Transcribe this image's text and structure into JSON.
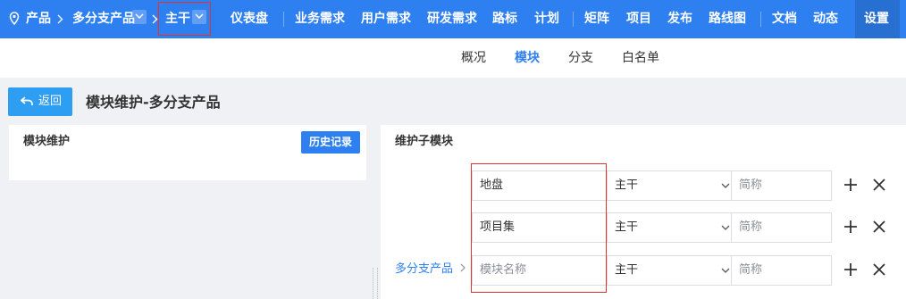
{
  "nav": {
    "breadcrumb": {
      "product": "产品",
      "product_name": "多分支产品",
      "branch": "主干"
    },
    "menu": [
      "仪表盘",
      "业务需求",
      "用户需求",
      "研发需求",
      "路标",
      "计划",
      "矩阵",
      "项目",
      "发布",
      "路线图",
      "文档",
      "动态",
      "设置"
    ]
  },
  "subnav": {
    "tabs": [
      "概况",
      "模块",
      "分支",
      "白名单"
    ],
    "active": "模块"
  },
  "header": {
    "back_label": "返回",
    "title": "模块维护-多分支产品"
  },
  "left_panel": {
    "title": "模块维护",
    "history_button": "历史记录"
  },
  "right_panel": {
    "title": "维护子模块",
    "parent_label": "多分支产品",
    "rows": [
      {
        "name": "地盘",
        "name_placeholder": "",
        "branch": "主干",
        "short_placeholder": "简称"
      },
      {
        "name": "项目集",
        "name_placeholder": "",
        "branch": "主干",
        "short_placeholder": "简称"
      },
      {
        "name": "",
        "name_placeholder": "模块名称",
        "branch": "主干",
        "short_placeholder": "简称"
      }
    ]
  },
  "colors": {
    "nav_bg": "#2e7ff0",
    "highlight_border": "#e0342b",
    "back_button": "#2e9ef3"
  }
}
